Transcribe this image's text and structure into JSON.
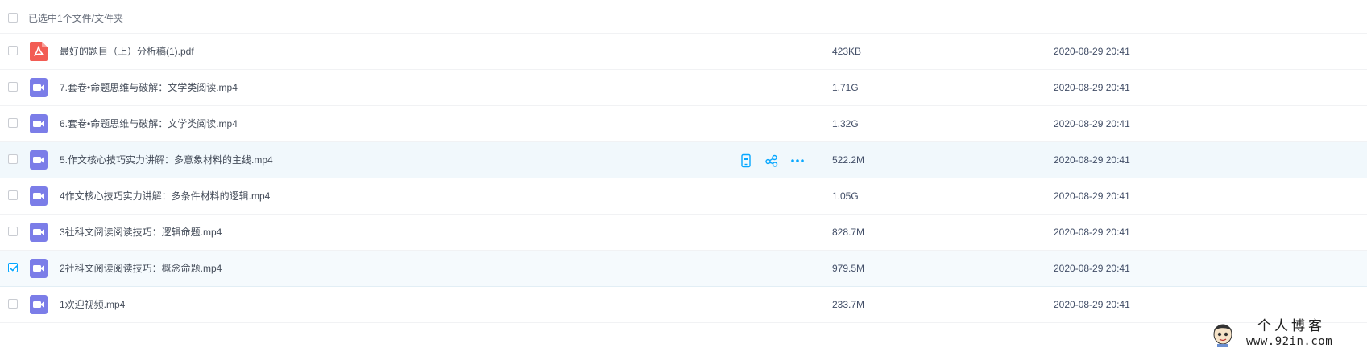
{
  "header": {
    "selection_text": "已选中1个文件/文件夹"
  },
  "files": [
    {
      "name": "最好的题目（上）分析稿(1).pdf",
      "size": "423KB",
      "date": "2020-08-29 20:41",
      "type": "pdf",
      "checked": false
    },
    {
      "name": "7.套卷•命题思维与破解：文学类阅读.mp4",
      "size": "1.71G",
      "date": "2020-08-29 20:41",
      "type": "video",
      "checked": false
    },
    {
      "name": "6.套卷•命题思维与破解：文学类阅读.mp4",
      "size": "1.32G",
      "date": "2020-08-29 20:41",
      "type": "video",
      "checked": false
    },
    {
      "name": "5.作文核心技巧实力讲解：多意象材料的主线.mp4",
      "size": "522.2M",
      "date": "2020-08-29 20:41",
      "type": "video",
      "checked": false
    },
    {
      "name": "4作文核心技巧实力讲解：多条件材料的逻辑.mp4",
      "size": "1.05G",
      "date": "2020-08-29 20:41",
      "type": "video",
      "checked": false
    },
    {
      "name": "3社科文阅读阅读技巧：逻辑命题.mp4",
      "size": "828.7M",
      "date": "2020-08-29 20:41",
      "type": "video",
      "checked": false
    },
    {
      "name": "2社科文阅读阅读技巧：概念命题.mp4",
      "size": "979.5M",
      "date": "2020-08-29 20:41",
      "type": "video",
      "checked": true
    },
    {
      "name": "1欢迎视频.mp4",
      "size": "233.7M",
      "date": "2020-08-29 20:41",
      "type": "video",
      "checked": false
    }
  ],
  "row_actions": [
    "phone-save-icon",
    "share-icon",
    "more-icon"
  ],
  "colors": {
    "accent": "#06a7ff",
    "pdf_icon": "#f25c54",
    "video_icon": "#7b7de8",
    "hover_row": "#f1f8fc"
  },
  "watermark": {
    "title": "个人博客",
    "url": "www.92in.com"
  }
}
